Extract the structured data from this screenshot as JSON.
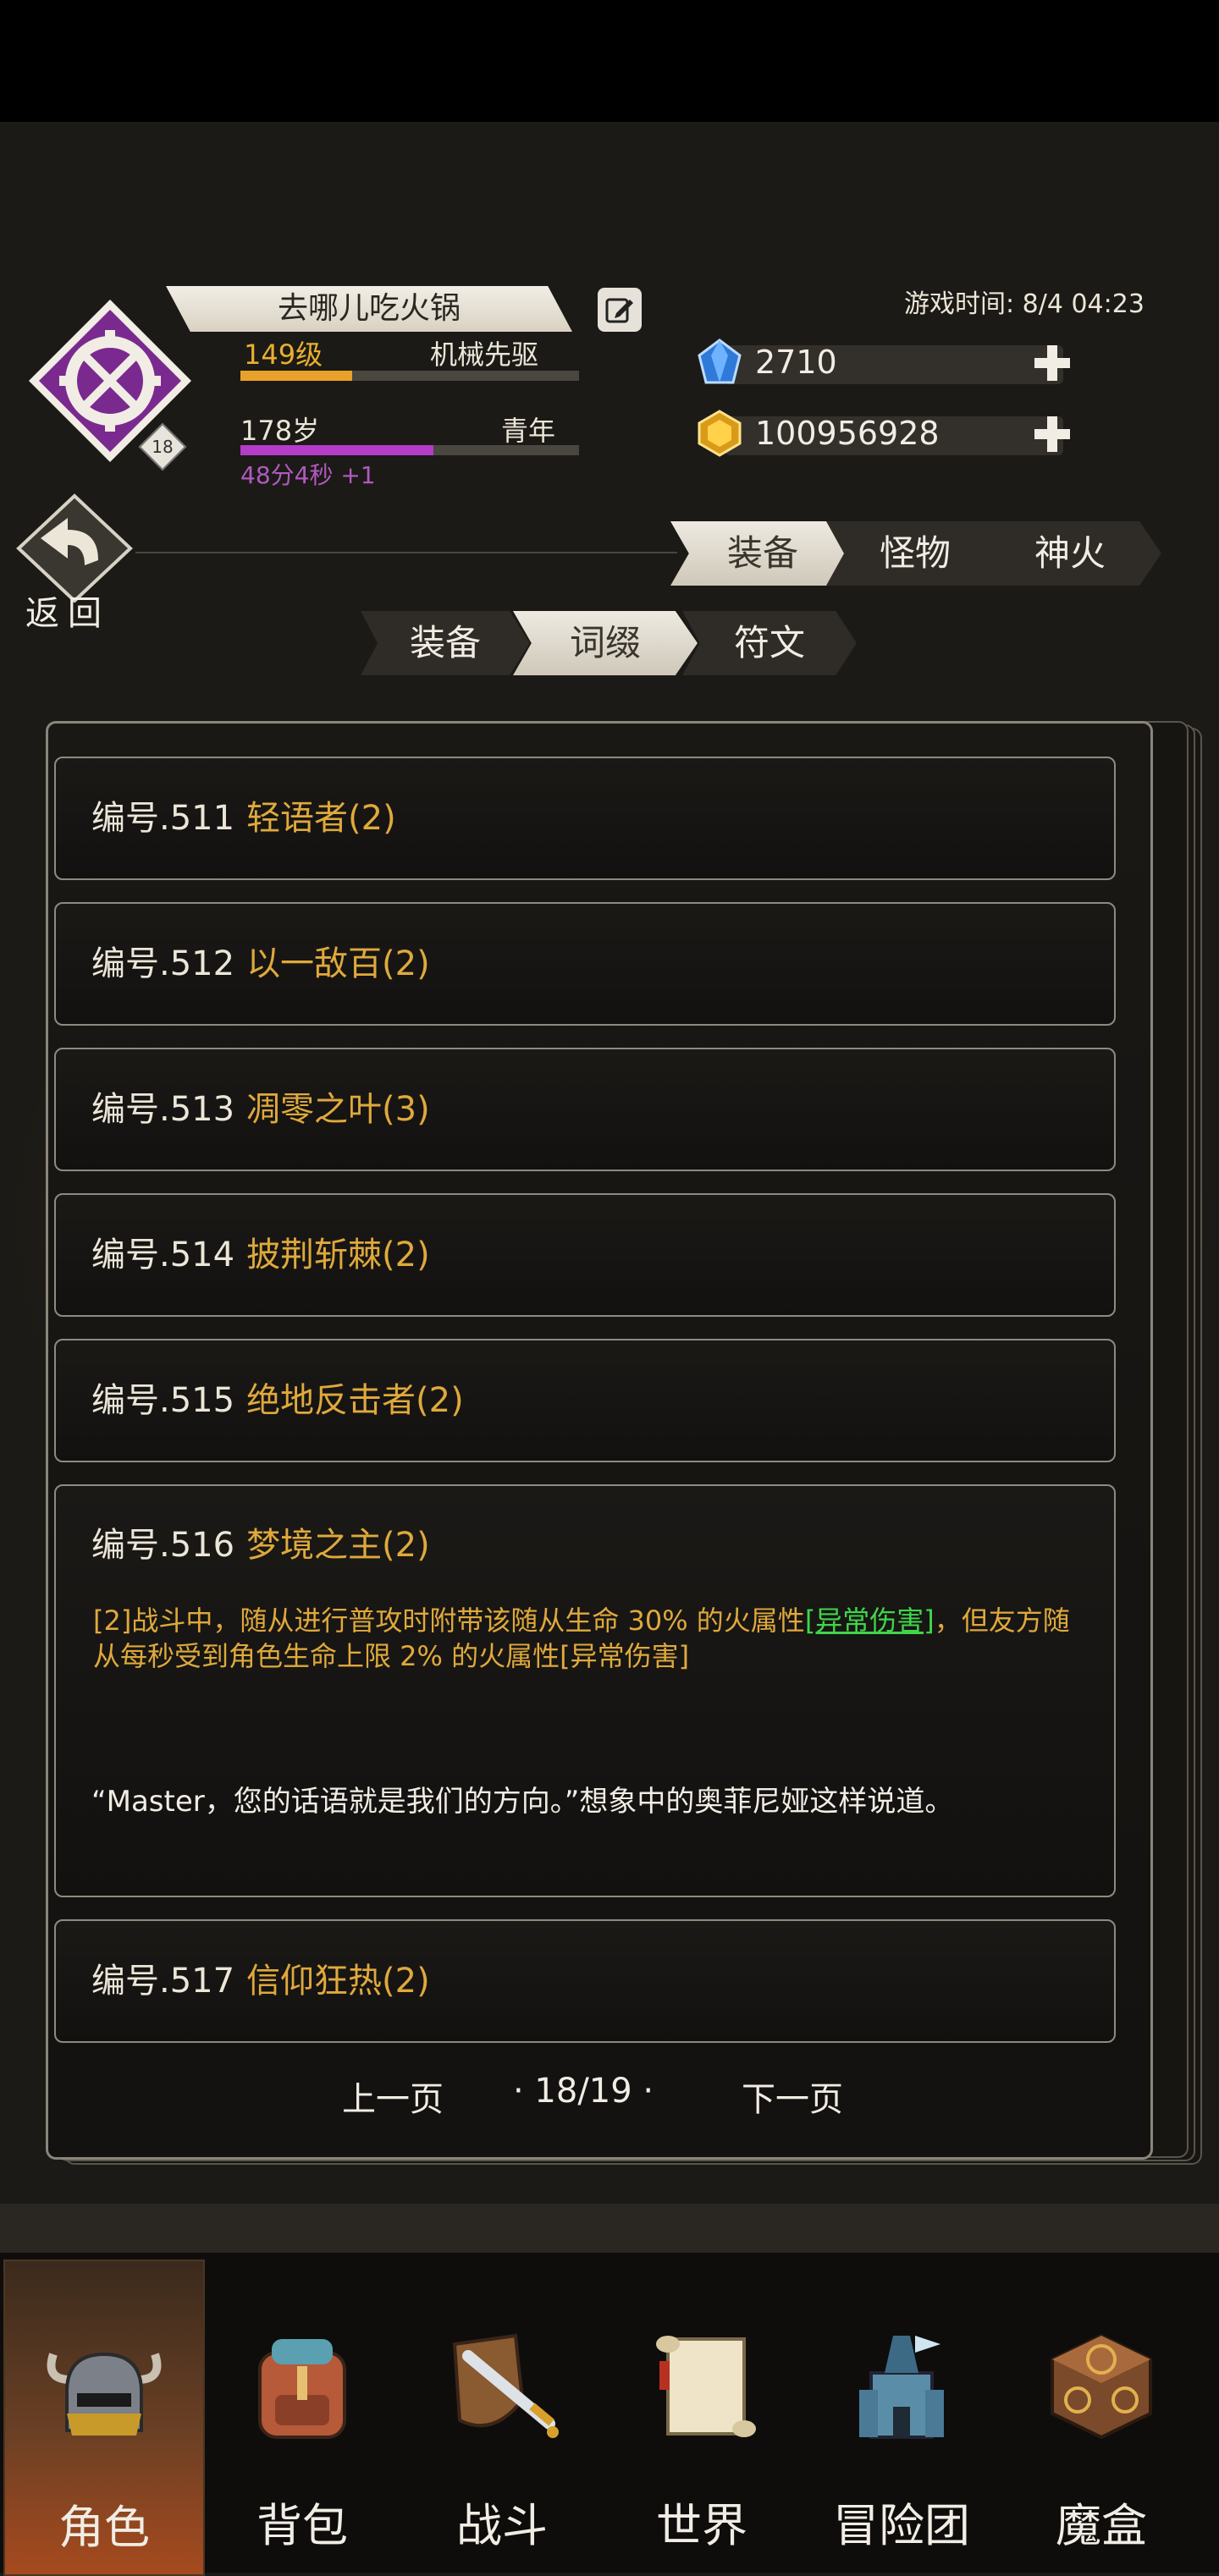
{
  "header": {
    "faint_title": "",
    "player_name": "去哪儿吃火锅",
    "level_label": "149级",
    "class_name": "机械先驱",
    "level_badge": "18",
    "age_label": "178岁",
    "age_stage": "青年",
    "age_timer": "48分4秒 +1",
    "game_time_label": "游戏时间: 8/4 04:23",
    "crystals": "2710",
    "gold": "100956928",
    "back_label": "返回",
    "level_progress": 0.33,
    "age_progress": 0.57
  },
  "tabs_main": [
    {
      "label": "装备",
      "active": true
    },
    {
      "label": "怪物",
      "active": false
    },
    {
      "label": "神火",
      "active": false
    }
  ],
  "tabs_sub": [
    {
      "label": "装备",
      "active": false
    },
    {
      "label": "词缀",
      "active": true
    },
    {
      "label": "符文",
      "active": false
    }
  ],
  "list": {
    "items": [
      {
        "num": "编号.511",
        "name": "轻语者(2)"
      },
      {
        "num": "编号.512",
        "name": "以一敌百(2)"
      },
      {
        "num": "编号.513",
        "name": "凋零之叶(3)"
      },
      {
        "num": "编号.514",
        "name": "披荆斩棘(2)"
      },
      {
        "num": "编号.515",
        "name": "绝地反击者(2)"
      },
      {
        "num": "编号.516",
        "name": "梦境之主(2)",
        "effect_pre": "[2]战斗中，随从进行普攻时附带该随从生命 30% 的火属性",
        "effect_link": "[异常伤害]",
        "effect_post": "，但友方随从每秒受到角色生命上限 2% 的火属性[异常伤害]",
        "flavor": "“Master，您的话语就是我们的方向。”想象中的奥菲尼娅这样说道。"
      },
      {
        "num": "编号.517",
        "name": "信仰狂热(2)"
      }
    ]
  },
  "pager": {
    "prev": "上一页",
    "page": "· 18/19 ·",
    "next": "下一页"
  },
  "nav": [
    {
      "label": "角色",
      "icon": "helmet-icon",
      "active": true
    },
    {
      "label": "背包",
      "icon": "backpack-icon",
      "active": false
    },
    {
      "label": "战斗",
      "icon": "sword-shield-icon",
      "active": false
    },
    {
      "label": "世界",
      "icon": "scroll-icon",
      "active": false
    },
    {
      "label": "冒险团",
      "icon": "castle-icon",
      "active": false
    },
    {
      "label": "魔盒",
      "icon": "magic-box-icon",
      "active": false
    }
  ],
  "colors": {
    "accent_gold": "#dfa93c",
    "link_green": "#3fd64a",
    "level_bar": "#e8a22a",
    "age_bar": "#b43cc8",
    "class_purple": "#7a2a8e"
  }
}
